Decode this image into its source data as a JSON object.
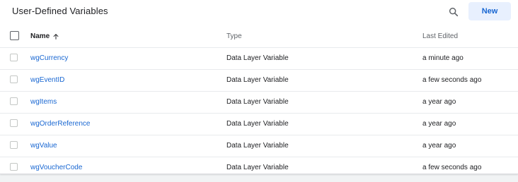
{
  "header": {
    "title": "User-Defined Variables",
    "new_label": "New"
  },
  "table": {
    "columns": {
      "name": "Name",
      "type": "Type",
      "last_edited": "Last Edited"
    },
    "rows": [
      {
        "name": "wgCurrency",
        "type": "Data Layer Variable",
        "last_edited": "a minute ago"
      },
      {
        "name": "wgEventID",
        "type": "Data Layer Variable",
        "last_edited": "a few seconds ago"
      },
      {
        "name": "wgItems",
        "type": "Data Layer Variable",
        "last_edited": "a year ago"
      },
      {
        "name": "wgOrderReference",
        "type": "Data Layer Variable",
        "last_edited": "a year ago"
      },
      {
        "name": "wgValue",
        "type": "Data Layer Variable",
        "last_edited": "a year ago"
      },
      {
        "name": "wgVoucherCode",
        "type": "Data Layer Variable",
        "last_edited": "a few seconds ago"
      }
    ]
  },
  "icons": {
    "search": "search-icon",
    "sort": "arrow-up-icon"
  },
  "colors": {
    "accent": "#1967d2",
    "button_bg": "#e8f0fe"
  }
}
